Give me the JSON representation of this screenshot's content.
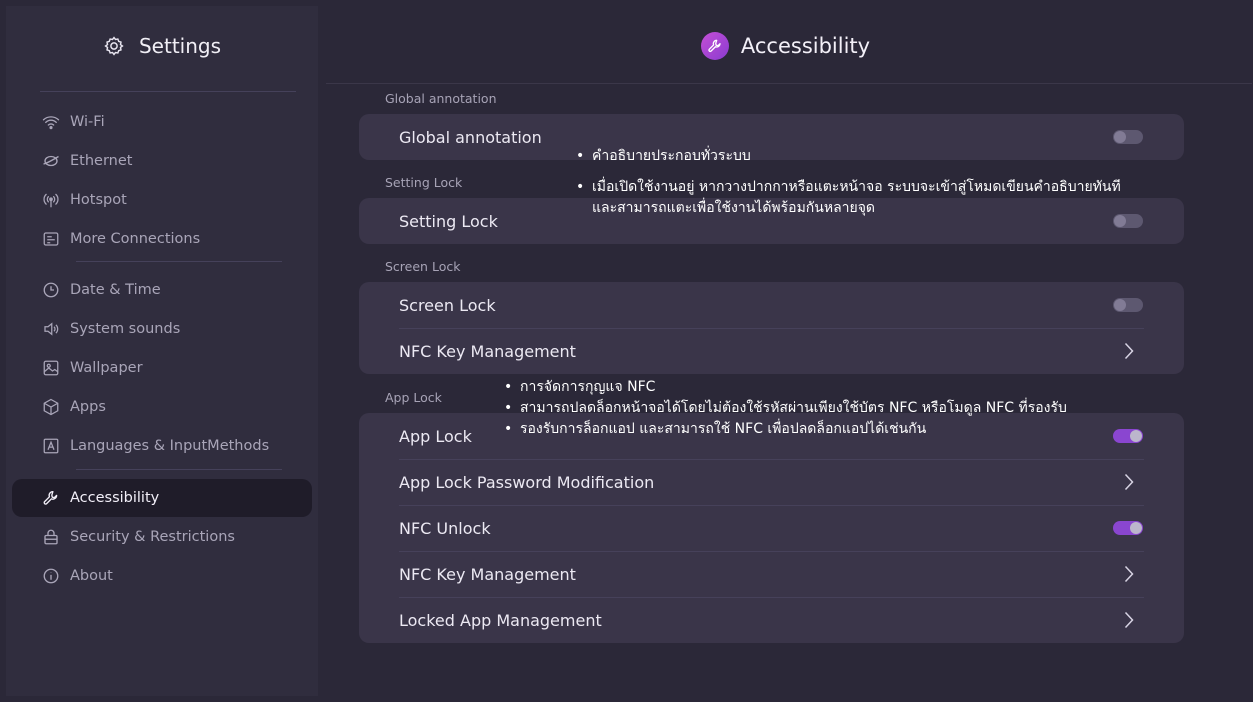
{
  "sidebar": {
    "title": "Settings",
    "items": [
      {
        "label": "Wi-Fi",
        "icon": "wifi-icon"
      },
      {
        "label": "Ethernet",
        "icon": "ethernet-icon"
      },
      {
        "label": "Hotspot",
        "icon": "hotspot-icon"
      },
      {
        "label": "More Connections",
        "icon": "more-connections-icon"
      },
      {
        "label": "Date & Time",
        "icon": "clock-icon"
      },
      {
        "label": "System sounds",
        "icon": "speaker-icon"
      },
      {
        "label": "Wallpaper",
        "icon": "wallpaper-icon"
      },
      {
        "label": "Apps",
        "icon": "apps-icon"
      },
      {
        "label": "Languages & InputMethods",
        "icon": "language-icon"
      },
      {
        "label": "Accessibility",
        "icon": "wrench-icon",
        "active": true
      },
      {
        "label": "Security & Restrictions",
        "icon": "lock-icon"
      },
      {
        "label": "About",
        "icon": "info-icon"
      }
    ]
  },
  "header": {
    "title": "Accessibility",
    "icon": "wrench-icon",
    "accent": "#a946d6"
  },
  "sections": {
    "global_annotation": {
      "label": "Global annotation",
      "rows": [
        {
          "label": "Global annotation",
          "type": "toggle",
          "value": false
        }
      ]
    },
    "setting_lock": {
      "label": "Setting Lock",
      "rows": [
        {
          "label": "Setting Lock",
          "type": "toggle",
          "value": false
        }
      ]
    },
    "screen_lock": {
      "label": "Screen Lock",
      "rows": [
        {
          "label": "Screen Lock",
          "type": "toggle",
          "value": false
        },
        {
          "label": "NFC Key Management",
          "type": "link"
        }
      ]
    },
    "app_lock": {
      "label": "App Lock",
      "rows": [
        {
          "label": "App Lock",
          "type": "toggle",
          "value": true
        },
        {
          "label": "App Lock Password Modification",
          "type": "link"
        },
        {
          "label": "NFC Unlock",
          "type": "toggle",
          "value": true
        },
        {
          "label": "NFC Key Management",
          "type": "link"
        },
        {
          "label": "Locked App Management",
          "type": "link"
        }
      ]
    }
  },
  "annotations": {
    "global": [
      "คำอธิบายประกอบทั่วระบบ",
      "เมื่อเปิดใช้งานอยู่ หากวางปากกาหรือแตะหน้าจอ ระบบจะเข้าสู่โหมดเขียนคำอธิบายทันที",
      "และสามารถแตะเพื่อใช้งานได้พร้อมกันหลายจุด"
    ],
    "nfc": [
      "การจัดการกุญแจ NFC",
      "สามารถปลดล็อกหน้าจอได้โดยไม่ต้องใช้รหัสผ่านเพียงใช้บัตร NFC หรือโมดูล NFC ที่รองรับ",
      "รองรับการล็อกแอป และสามารถใช้ NFC เพื่อปลดล็อกแอปได้เช่นกัน"
    ]
  },
  "colors": {
    "toggle_on": "#8a46d0",
    "toggle_off": "#5d5870",
    "card": "#3a3549",
    "background": "#2b2838",
    "sidebar": "#302d3e"
  }
}
